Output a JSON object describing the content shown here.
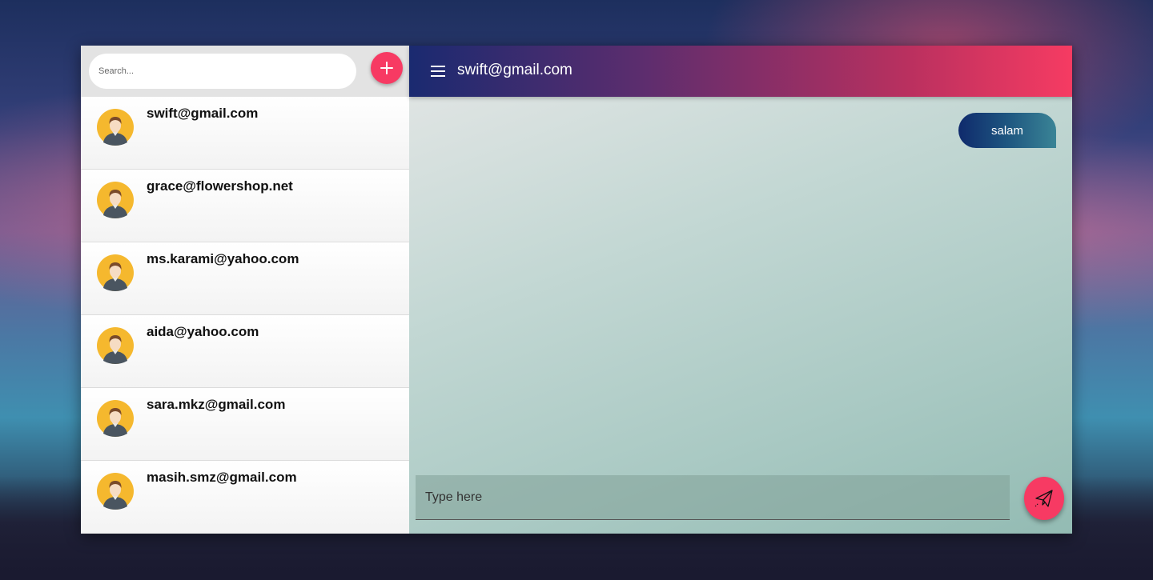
{
  "sidebar": {
    "search": {
      "placeholder": "Search...",
      "value": ""
    },
    "add_button_icon": "plus-icon",
    "contacts": [
      {
        "name": "swift@gmail.com",
        "avatar_icon": "user-avatar-icon"
      },
      {
        "name": "grace@flowershop.net",
        "avatar_icon": "user-avatar-icon"
      },
      {
        "name": "ms.karami@yahoo.com",
        "avatar_icon": "user-avatar-icon"
      },
      {
        "name": "aida@yahoo.com",
        "avatar_icon": "user-avatar-icon"
      },
      {
        "name": "sara.mkz@gmail.com",
        "avatar_icon": "user-avatar-icon"
      },
      {
        "name": "masih.smz@gmail.com",
        "avatar_icon": "user-avatar-icon"
      }
    ]
  },
  "chat": {
    "header": {
      "menu_icon": "hamburger-menu-icon",
      "title": "swift@gmail.com"
    },
    "messages": [
      {
        "text": "salam",
        "direction": "sent"
      }
    ],
    "composer": {
      "placeholder": "Type here",
      "value": "",
      "send_icon": "paper-plane-icon"
    }
  },
  "colors": {
    "accent": "#f73a63",
    "header_gradient_start": "#1a2a70",
    "header_gradient_end": "#f63b62",
    "bubble_gradient_start": "#0f2a6c",
    "bubble_gradient_end": "#3a8496"
  }
}
